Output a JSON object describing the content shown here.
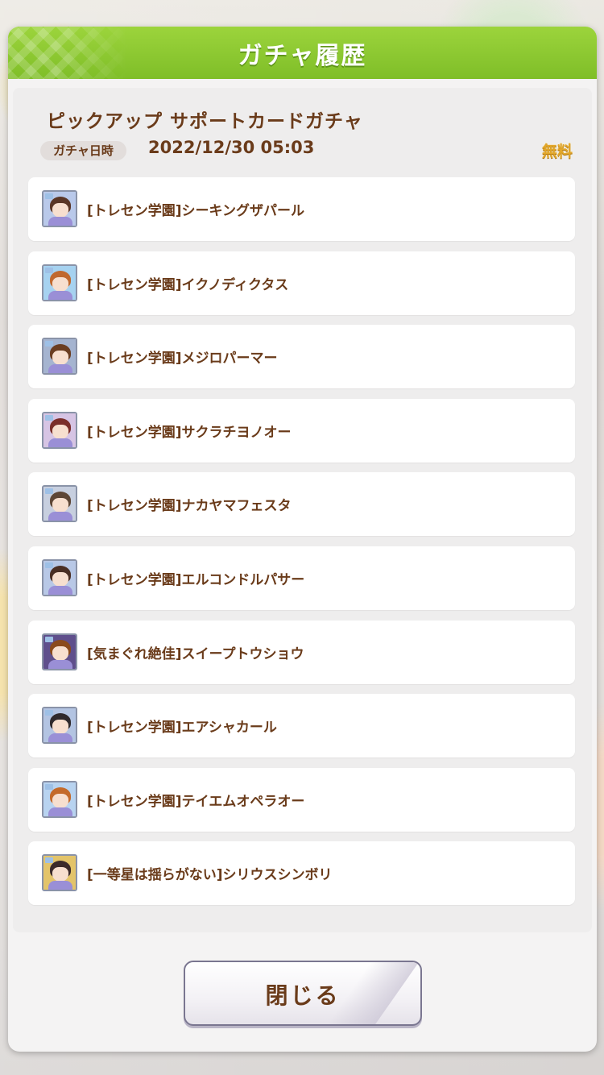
{
  "dialog": {
    "title": "ガチャ履歴",
    "banner_title": "ピックアップ サポートカードガチャ",
    "date_tag": "ガチャ日時",
    "date_value": "2022/12/30 05:03",
    "cost_label": "無料",
    "close_label": "閉じる"
  },
  "items": [
    {
      "label": "[トレセン学園]シーキングザパール",
      "icon": "character-card-icon",
      "hair_color": "#5a3626",
      "sky_color": "#b9c9ea"
    },
    {
      "label": "[トレセン学園]イクノディクタス",
      "icon": "character-card-icon",
      "hair_color": "#c0682e",
      "sky_color": "#a6d2f0"
    },
    {
      "label": "[トレセン学園]メジロパーマー",
      "icon": "character-card-icon",
      "hair_color": "#6b3e22",
      "sky_color": "#a5b4d0"
    },
    {
      "label": "[トレセン学園]サクラチヨノオー",
      "icon": "character-card-icon",
      "hair_color": "#7a2e2a",
      "sky_color": "#d6c4e4"
    },
    {
      "label": "[トレセン学園]ナカヤマフェスタ",
      "icon": "character-card-icon",
      "hair_color": "#5d4636",
      "sky_color": "#c7cfdf"
    },
    {
      "label": "[トレセン学園]エルコンドルパサー",
      "icon": "character-card-icon",
      "hair_color": "#4a2f24",
      "sky_color": "#b8c8e6"
    },
    {
      "label": "[気まぐれ絶佳]スイープトウショウ",
      "icon": "character-card-icon",
      "hair_color": "#8a4a1c",
      "sky_color": "#5f4f8c"
    },
    {
      "label": "[トレセン学園]エアシャカール",
      "icon": "character-card-icon",
      "hair_color": "#2f2a2d",
      "sky_color": "#b3c4e2"
    },
    {
      "label": "[トレセン学園]テイエムオペラオー",
      "icon": "character-card-icon",
      "hair_color": "#c46a2a",
      "sky_color": "#b8d3f0"
    },
    {
      "label": "[一等星は揺らがない]シリウスシンボリ",
      "icon": "character-card-icon",
      "hair_color": "#3b2a2a",
      "sky_color": "#e3c46a"
    }
  ],
  "colors": {
    "header_green": "#8cc833",
    "text_brown": "#6a3b1a",
    "free_gold": "#e1a62a"
  }
}
